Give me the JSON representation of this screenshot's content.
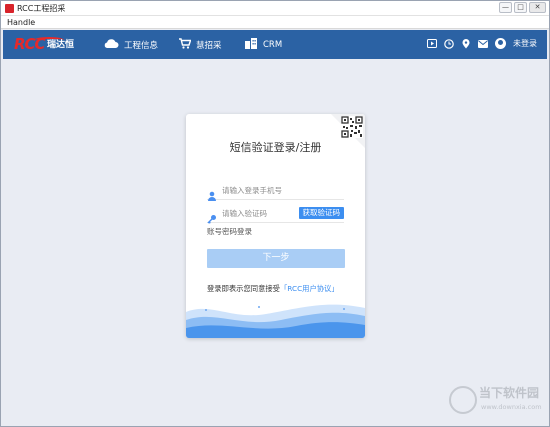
{
  "window": {
    "title": "RCC工程招采",
    "minimize": "—",
    "maximize": "□",
    "close": "✕"
  },
  "menubar": {
    "handle": "Handle"
  },
  "nav": {
    "logo_text": "RCC",
    "logo_cn": "瑞达恒",
    "items": [
      {
        "label": "工程信息",
        "icon": "cloud-icon"
      },
      {
        "label": "慧招采",
        "icon": "cart-icon"
      },
      {
        "label": "CRM",
        "icon": "building-icon"
      }
    ],
    "tools": [
      "play-icon",
      "clock-icon",
      "location-icon",
      "mail-icon"
    ],
    "login_status": "未登录"
  },
  "login": {
    "title": "短信验证登录/注册",
    "phone_placeholder": "请输入登录手机号",
    "code_placeholder": "请输入验证码",
    "get_code": "获取验证码",
    "password_login": "账号密码登录",
    "next": "下一步",
    "agree_prefix": "登录即表示您同意接受",
    "agree_link": "「RCC用户协议」"
  },
  "watermark": {
    "line1": "当下软件园",
    "line2": "www.downxia.com"
  },
  "colors": {
    "navbar": "#2b62a4",
    "brand_red": "#e52a2a",
    "accent_blue": "#3c8ef0",
    "button_disabled": "#a9cdf5",
    "background": "#e9ecf3"
  }
}
